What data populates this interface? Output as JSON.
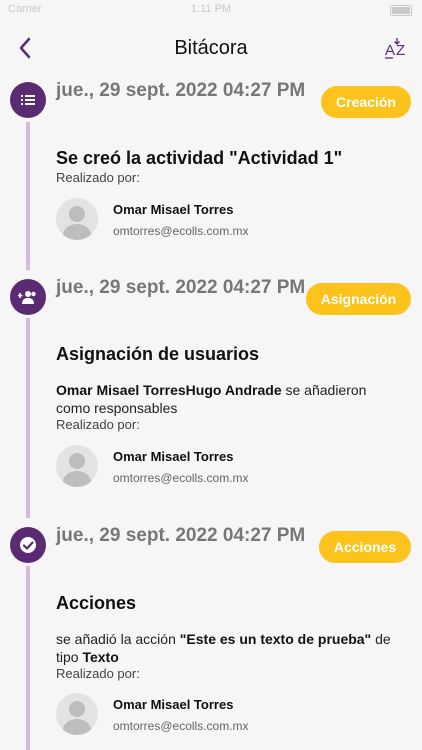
{
  "status_bar": {
    "carrier": "Carrier",
    "time": "1:11 PM"
  },
  "header": {
    "title": "Bitácora",
    "back_icon": "chevron-left-icon",
    "sort_icon": "sort-az-icon"
  },
  "colors": {
    "accent": "#5a2a73",
    "badge": "#fbc31b",
    "timeline": "#d6b8e1"
  },
  "entries": [
    {
      "icon": "list-icon",
      "date": "jue., 29 sept. 2022 04:27 PM",
      "badge": "Creación",
      "title": "Se creó la actividad \"Actividad 1\"",
      "done_by_label": "Realizado por:",
      "user": {
        "name": "Omar Misael Torres",
        "email": "omtorres@ecolls.com.mx"
      }
    },
    {
      "icon": "add-users-icon",
      "date": "jue., 29 sept. 2022 04:27 PM",
      "badge": "Asignación",
      "title": "Asignación de usuarios",
      "desc_bold": "Omar Misael TorresHugo Andrade",
      "desc_rest": " se añadieron como responsables",
      "done_by_label": "Realizado por:",
      "user": {
        "name": "Omar Misael Torres",
        "email": "omtorres@ecolls.com.mx"
      }
    },
    {
      "icon": "check-circle-icon",
      "date": "jue., 29 sept. 2022 04:27 PM",
      "badge": "Acciones",
      "title": "Acciones",
      "desc_pre": "se añadió la acción ",
      "desc_bold": "\"Este es un texto de prueba\"",
      "desc_mid": " de tipo ",
      "desc_type": "Texto",
      "done_by_label": "Realizado por:",
      "user": {
        "name": "Omar Misael Torres",
        "email": "omtorres@ecolls.com.mx"
      }
    }
  ]
}
